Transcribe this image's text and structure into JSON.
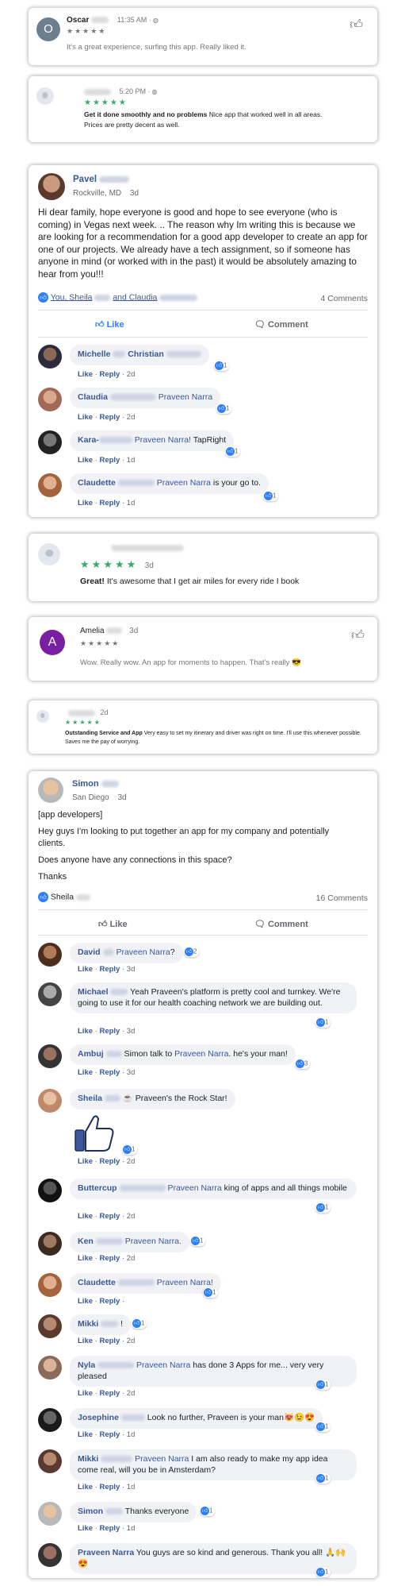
{
  "review_oscar": {
    "name": "Oscar",
    "time": "11:35 AM",
    "stars": "★★★★★",
    "text": "It's a great experience, surfing this app. Really liked it.",
    "avatar_letter": "O"
  },
  "review_blank1": {
    "time": "5:20 PM",
    "stars": "★★★★★",
    "title": "Get it done smoothly and no problems",
    "text": "Nice app that worked well in all areas. Prices are pretty decent as well."
  },
  "post_pavel": {
    "name": "Pavel",
    "location": "Rockville, MD",
    "age": "3d",
    "text": "Hi dear family, hope everyone is good and hope to see everyone (who is coming) in Vegas next week. .. The reason why Im writing this is because we are looking for a recommendation for a good app developer to create an app for one of our projects. We already have a tech assignment, so if someone has anyone in mind (or worked with in the past) it would be absolutely amazing to hear from you!!!",
    "reactors_a": "You, Sheila",
    "reactors_b": "and Claudia",
    "comments_count": "4 Comments",
    "like_label": "Like",
    "comment_label": "Comment",
    "comments": [
      {
        "name": "Michelle",
        "name2": "Christian",
        "text": "",
        "count": "1",
        "age": "2d"
      },
      {
        "name": "Claudia",
        "tag": "Praveen Narra",
        "text": "",
        "count": "1",
        "age": "2d"
      },
      {
        "name": "Kara-",
        "tag": "Praveen Narra!",
        "text": " TapRight",
        "count": "1",
        "age": "1d"
      },
      {
        "name": "Claudette",
        "tag": "Praveen Narra",
        "text": " is your go to.",
        "count": "1",
        "age": "1d"
      }
    ]
  },
  "review_blank2": {
    "stars": "★★★★★",
    "age": "3d",
    "title": "Great!",
    "text": "It's awesome that I get air miles for every ride I book"
  },
  "review_amelia": {
    "name": "Amelia",
    "age": "3d",
    "stars": "★★★★★",
    "text": "Wow. Really wow. An app for moments to happen. That's really 😎",
    "avatar_letter": "A"
  },
  "review_blank3": {
    "age": "2d",
    "stars": "★★★★★",
    "title": "Outstanding Service and App",
    "text": "Very easy to set my itinerary and driver was right on time. I'll use this whenever possible. Saves me the pay of worrying."
  },
  "post_simon": {
    "name": "Simon",
    "location": "San Diego",
    "age": "3d",
    "line1": "[app developers]",
    "line2": "Hey guys I'm looking to put together an app for my company and potentially clients.",
    "line3": "Does anyone have any connections in this space?",
    "line4": "Thanks",
    "reactors": "Sheila",
    "comments_count": "16 Comments",
    "like_label": "Like",
    "comment_label": "Comment",
    "comments": [
      {
        "name": "David",
        "tag": "Praveen Narra",
        "text": "?",
        "count": "2",
        "age": "3d"
      },
      {
        "name": "Michael",
        "text": "Yeah Praveen's platform is pretty cool and turnkey. We're going to use it for our health coaching network we are building out.",
        "count": "1",
        "age": "3d"
      },
      {
        "name": "Ambuj",
        "text": "Simon talk to ",
        "tag": "Praveen Narra",
        "text2": ". he's your man!",
        "count": "3",
        "age": "3d"
      },
      {
        "name": "Sheila",
        "text": "☕ Praveen's the Rock Star!",
        "count": "1",
        "age": "2d"
      },
      {
        "name": "Buttercup",
        "tag": "Praveen Narra",
        "text": " king of apps and all things mobile",
        "count": "1",
        "age": "2d"
      },
      {
        "name": "Ken",
        "tag": "Praveen Narra.",
        "count": "1",
        "age": "2d"
      },
      {
        "name": "Claudette",
        "tag": "Praveen Narra!",
        "count": "1",
        "age": ""
      },
      {
        "name": "Mikki",
        "text": "!",
        "count": "1",
        "age": "2d"
      },
      {
        "name": "Nyla",
        "tag": "Praveen Narra",
        "text": " has done 3 Apps for me... very very pleased",
        "count": "1",
        "age": "2d"
      },
      {
        "name": "Josephine",
        "text": "Look no further, Praveen is your man😻😉😍",
        "count": "1",
        "age": "1d"
      },
      {
        "name": "Mikki",
        "tag": "Praveen Narra",
        "text": " I am also ready to make my app idea come real, will you be in Amsterdam?",
        "count": "1",
        "age": "1d"
      },
      {
        "name": "Simon",
        "text": "Thanks everyone",
        "count": "1",
        "age": "1d"
      },
      {
        "name": "Praveen Narra",
        "text": "You guys are so kind and generous. Thank you all! 🙏🙌😍",
        "count": "1",
        "age": ""
      }
    ]
  },
  "labels": {
    "like": "Like",
    "reply": "Reply"
  },
  "colors": {
    "fb_blue": "#385898",
    "like_blue": "#2d7ff9",
    "green_stars": "#3aa86b",
    "purple_avatar": "#7b1fa2"
  }
}
